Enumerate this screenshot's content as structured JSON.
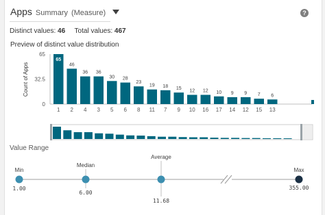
{
  "header": {
    "field_name": "Apps",
    "summary_label": "Summary",
    "measure_label": "(Measure)",
    "help_icon": "question-circle-icon"
  },
  "stats": {
    "distinct_label": "Distinct values:",
    "distinct_value": "46",
    "total_label": "Total values:",
    "total_value": "467"
  },
  "preview_title": "Preview of distinct value distribution",
  "chart_data": {
    "type": "bar",
    "ylabel": "Count of Apps",
    "yticks": [
      "65",
      "32.5",
      "0"
    ],
    "ylim": [
      0,
      65
    ],
    "categories": [
      "1",
      "2",
      "4",
      "3",
      "5",
      "6",
      "8",
      "11",
      "7",
      "9",
      "10",
      "16",
      "17",
      "14",
      "12",
      "15",
      "13"
    ],
    "values": [
      65,
      46,
      36,
      36,
      30,
      28,
      23,
      19,
      18,
      15,
      12,
      12,
      10,
      9,
      9,
      7,
      6
    ],
    "value_labels": [
      "65",
      "46",
      "36",
      "36",
      "30",
      "28",
      "23",
      "19",
      "18",
      "15",
      "12",
      "12",
      "10",
      "9",
      "9",
      "7",
      "6"
    ],
    "bar_color": "#00677f",
    "grid": false,
    "overview_values": [
      65,
      46,
      36,
      36,
      30,
      28,
      23,
      19,
      18,
      15,
      12,
      12,
      10,
      9,
      9,
      7,
      6,
      6,
      5,
      5,
      4,
      4,
      3,
      3,
      3
    ]
  },
  "value_range": {
    "title": "Value Range",
    "min_label": "Min",
    "min_value": "1.00",
    "median_label": "Median",
    "median_value": "6.00",
    "average_label": "Average",
    "average_value": "11.68",
    "max_label": "Max",
    "max_value": "355.00",
    "point_color": "#3d8fb0",
    "max_point_color": "#1a2f44"
  }
}
